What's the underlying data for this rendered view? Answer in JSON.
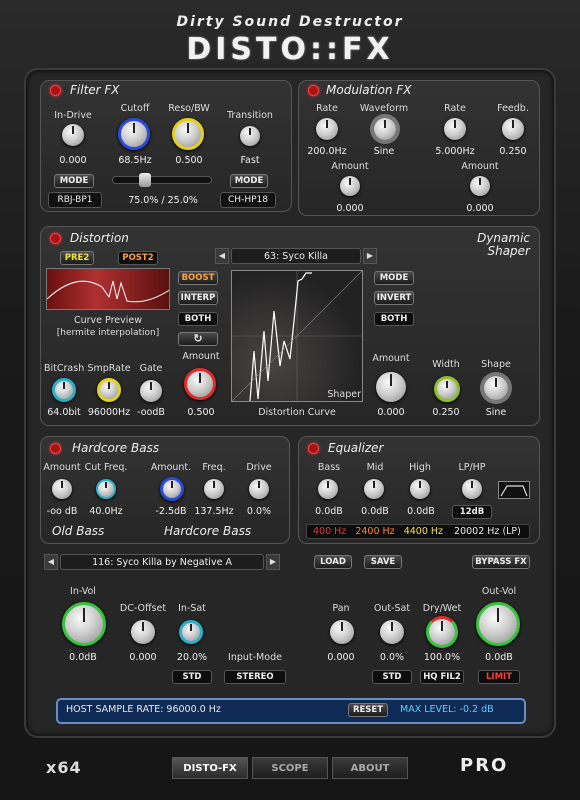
{
  "header": {
    "subtitle": "Dirty Sound Destructor",
    "logo": "DISTO::FX"
  },
  "filter": {
    "title": "Filter FX",
    "indrive_label": "In-Drive",
    "indrive_value": "0.000",
    "cutoff_label": "Cutoff",
    "cutoff_value": "68.5Hz",
    "reso_label": "Reso/BW",
    "reso_value": "0.500",
    "transition_label": "Transition",
    "transition_value": "Fast",
    "mode_label": "MODE",
    "type1": "RBJ-BP1",
    "mix_value": "75.0% / 25.0%",
    "mix_slider": 0.3,
    "type2": "CH-HP18"
  },
  "modulation": {
    "title": "Modulation FX",
    "rate1_label": "Rate",
    "rate1_value": "200.0Hz",
    "waveform_label": "Waveform",
    "waveform_value": "Sine",
    "rate2_label": "Rate",
    "rate2_value": "5.000Hz",
    "feedb_label": "Feedb.",
    "feedb_value": "0.250",
    "amount1_label": "Amount",
    "amount1_value": "0.000",
    "amount2_label": "Amount",
    "amount2_value": "0.000"
  },
  "distortion": {
    "title": "Distortion",
    "dyn_title1": "Dynamic",
    "dyn_title2": "Shaper",
    "pre_label": "PRE2",
    "post_label": "POST2",
    "boost_label": "BOOST",
    "interp_label": "INTERP",
    "both_label": "BOTH",
    "curve_preview_label": "Curve Preview",
    "curve_interp_label": "[hermite interpolation]",
    "preset": "63: Syco Killa",
    "mode_label": "MODE",
    "invert_label": "INVERT",
    "both2_label": "BOTH",
    "bitcrush_label": "BitCrash",
    "bitcrush_value": "64.0bit",
    "smprate_label": "SmpRate",
    "smprate_value": "96000Hz",
    "gate_label": "Gate",
    "gate_value": "-oodB",
    "amount_label": "Amount",
    "amount_value": "0.500",
    "shaper_label": "Shaper",
    "curve_label": "Distortion Curve",
    "dyn_amount_label": "Amount",
    "dyn_amount_value": "0.000",
    "width_label": "Width",
    "width_value": "0.250",
    "shape_label": "Shape",
    "shape_value": "Sine"
  },
  "bass": {
    "title": "Hardcore Bass",
    "amount1_label": "Amount",
    "amount1_value": "-oo dB",
    "cutfreq_label": "Cut Freq.",
    "cutfreq_value": "40.0Hz",
    "amount2_label": "Amount.",
    "amount2_value": "-2.5dB",
    "freq_label": "Freq.",
    "freq_value": "137.5Hz",
    "drive_label": "Drive",
    "drive_value": "0.0%",
    "old_bass_label": "Old Bass",
    "hardcore_bass_label": "Hardcore Bass"
  },
  "eq": {
    "title": "Equalizer",
    "bass_label": "Bass",
    "bass_value": "0.0dB",
    "mid_label": "Mid",
    "mid_value": "0.0dB",
    "high_label": "High",
    "high_value": "0.0dB",
    "lphp_label": "LP/HP",
    "slope_label": "12dB",
    "freq1": "400 Hz",
    "freq2": "2400 Hz",
    "freq3": "4400 Hz",
    "freq4": "20002 Hz (LP)",
    "colors": {
      "freq1": "#e63c2f",
      "freq2": "#ff8a2a",
      "freq3": "#f4e04a",
      "freq4": "#e8e8e8"
    }
  },
  "preset_bar": {
    "preset": "116: Syco Killa by Negative A",
    "load_label": "LOAD",
    "save_label": "SAVE",
    "bypass_label": "BYPASS FX"
  },
  "io": {
    "invol_label": "In-Vol",
    "invol_value": "0.0dB",
    "dcoffset_label": "DC-Offset",
    "dcoffset_value": "0.000",
    "insat_label": "In-Sat",
    "insat_value": "20.0%",
    "inputmode_label": "Input-Mode",
    "std_label": "STD",
    "stereo_label": "STEREO",
    "pan_label": "Pan",
    "pan_value": "0.000",
    "outsat_label": "Out-Sat",
    "outsat_value": "0.0%",
    "drywet_label": "Dry/Wet",
    "drywet_value": "100.0%",
    "outvol_label": "Out-Vol",
    "outvol_value": "0.0dB",
    "std2_label": "STD",
    "hqfil_label": "HQ FIL2",
    "limit_label": "LIMIT"
  },
  "status": {
    "sample_rate": "HOST SAMPLE RATE: 96000.0 Hz",
    "reset_label": "RESET",
    "max_level": "MAX LEVEL: -0.2 dB"
  },
  "footer": {
    "x64": "x64",
    "tab1": "DISTO-FX",
    "tab2": "SCOPE",
    "tab3": "ABOUT",
    "pro": "PRO"
  }
}
